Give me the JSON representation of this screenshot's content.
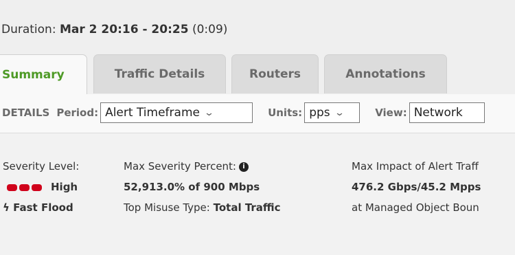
{
  "duration": {
    "label": "Duration:",
    "range": "Mar 2 20:16 - 20:25",
    "length": "(0:09)"
  },
  "tabs": [
    {
      "label": "Summary",
      "active": true
    },
    {
      "label": "Traffic Details",
      "active": false
    },
    {
      "label": "Routers",
      "active": false
    },
    {
      "label": "Annotations",
      "active": false
    }
  ],
  "details": {
    "label": "DETAILS",
    "period_label": "Period:",
    "period_value": "Alert Timeframe",
    "units_label": "Units:",
    "units_value": "pps",
    "view_label": "View:",
    "view_value": "Network"
  },
  "summary": {
    "severity_label": "Severity Level:",
    "severity_value": "High",
    "severity_color": "#d0021b",
    "misuse_short": "Fast Flood",
    "max_severity_label": "Max Severity Percent:",
    "max_severity_value": "52,913.0% of 900 Mbps",
    "top_misuse_label": "Top Misuse Type:",
    "top_misuse_value": "Total Traffic",
    "max_impact_label": "Max Impact of Alert Traff",
    "max_impact_value": "476.2 Gbps/45.2 Mpps",
    "managed_object": "at Managed Object Boun"
  },
  "colors": {
    "active_tab": "#4e9a26",
    "severity": "#d0021b"
  }
}
